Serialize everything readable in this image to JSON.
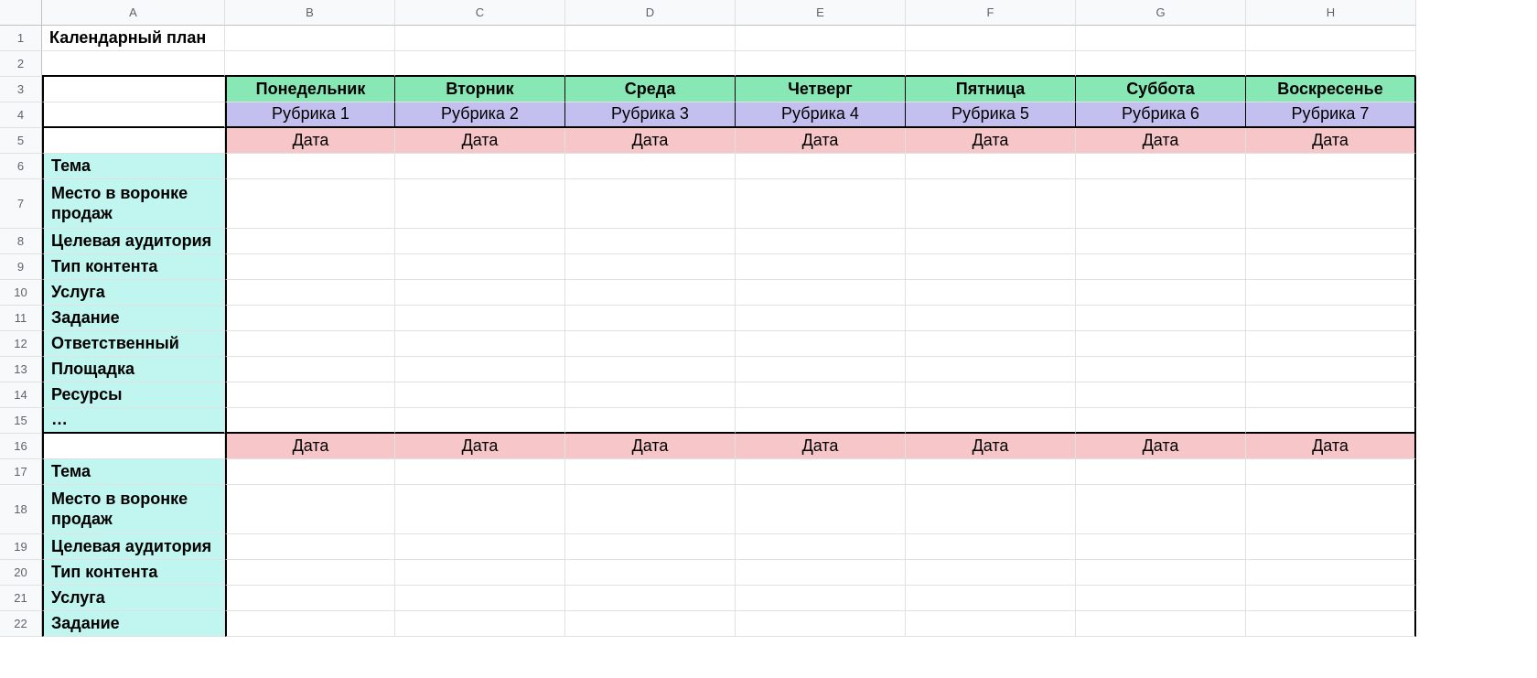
{
  "columns": [
    "A",
    "B",
    "C",
    "D",
    "E",
    "F",
    "G",
    "H"
  ],
  "title": "Календарный план",
  "days": [
    "Понедельник",
    "Вторник",
    "Среда",
    "Четверг",
    "Пятница",
    "Суббота",
    "Воскресенье"
  ],
  "rubrics": [
    "Рубрика 1",
    "Рубрика 2",
    "Рубрика 3",
    "Рубрика 4",
    "Рубрика 5",
    "Рубрика 6",
    "Рубрика 7"
  ],
  "date_label": "Дата",
  "row_labels_block": [
    "Тема",
    "Место в воронке продаж",
    "Целевая аудитория",
    "Тип контента",
    "Услуга",
    "Задание",
    "Ответственный",
    "Площадка",
    "Ресурсы",
    "…"
  ],
  "row_labels_block2_visible": [
    "Тема",
    "Место в воронке продаж",
    "Целевая аудитория",
    "Тип контента",
    "Услуга",
    "Задание"
  ],
  "row_numbers": [
    "1",
    "2",
    "3",
    "4",
    "5",
    "6",
    "7",
    "8",
    "9",
    "10",
    "11",
    "12",
    "13",
    "14",
    "15",
    "16",
    "17",
    "18",
    "19",
    "20",
    "21",
    "22"
  ]
}
